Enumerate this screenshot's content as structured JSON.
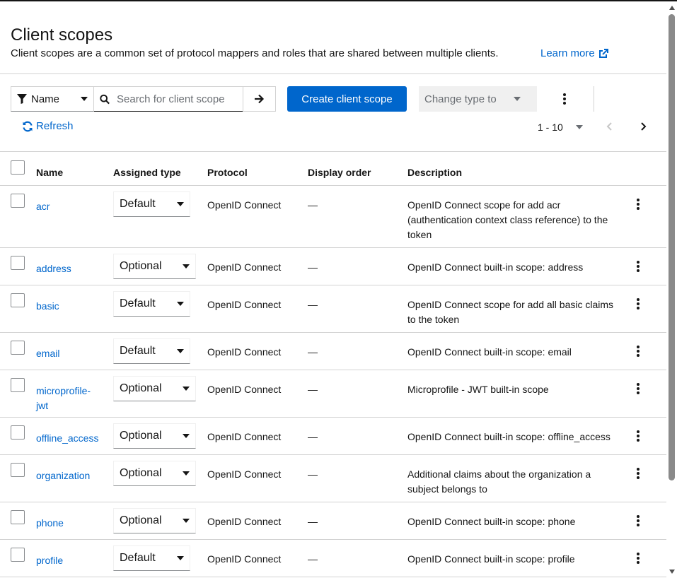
{
  "page": {
    "title": "Client scopes",
    "subtitle": "Client scopes are a common set of protocol mappers and roles that are shared between multiple clients.",
    "learn_more": "Learn more"
  },
  "toolbar": {
    "filter_label": "Name",
    "search_placeholder": "Search for client scope",
    "create_label": "Create client scope",
    "change_type_label": "Change type to",
    "refresh_label": "Refresh",
    "pagination": "1 - 10"
  },
  "table": {
    "headers": {
      "name": "Name",
      "assigned_type": "Assigned type",
      "protocol": "Protocol",
      "display_order": "Display order",
      "description": "Description"
    },
    "rows": [
      {
        "name": "acr",
        "type": "Default",
        "protocol": "OpenID Connect",
        "order": "—",
        "description": "OpenID Connect scope for add acr (authentication context class reference) to the token"
      },
      {
        "name": "address",
        "type": "Optional",
        "protocol": "OpenID Connect",
        "order": "—",
        "description": "OpenID Connect built-in scope: address"
      },
      {
        "name": "basic",
        "type": "Default",
        "protocol": "OpenID Connect",
        "order": "—",
        "description": "OpenID Connect scope for add all basic claims to the token"
      },
      {
        "name": "email",
        "type": "Default",
        "protocol": "OpenID Connect",
        "order": "—",
        "description": "OpenID Connect built-in scope: email"
      },
      {
        "name": "microprofile-jwt",
        "type": "Optional",
        "protocol": "OpenID Connect",
        "order": "—",
        "description": "Microprofile - JWT built-in scope"
      },
      {
        "name": "offline_access",
        "type": "Optional",
        "protocol": "OpenID Connect",
        "order": "—",
        "description": "OpenID Connect built-in scope: offline_access"
      },
      {
        "name": "organization",
        "type": "Optional",
        "protocol": "OpenID Connect",
        "order": "—",
        "description": "Additional claims about the organization a subject belongs to"
      },
      {
        "name": "phone",
        "type": "Optional",
        "protocol": "OpenID Connect",
        "order": "—",
        "description": "OpenID Connect built-in scope: phone"
      },
      {
        "name": "profile",
        "type": "Default",
        "protocol": "OpenID Connect",
        "order": "—",
        "description": "OpenID Connect built-in scope: profile"
      }
    ]
  },
  "colors": {
    "primary": "#0066cc",
    "text": "#151515",
    "border": "#d2d2d2",
    "disabled_bg": "#f0f0f0"
  }
}
